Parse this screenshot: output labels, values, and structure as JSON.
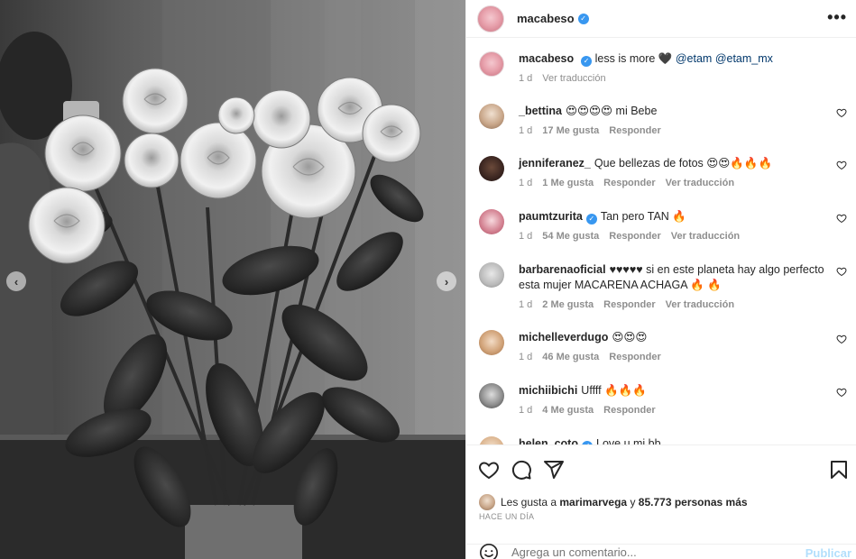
{
  "header": {
    "username": "macabeso",
    "more_label": "•••"
  },
  "caption": {
    "username": "macabeso",
    "text": "less is more 🖤",
    "mentions": [
      "@etam",
      "@etam_mx"
    ],
    "time": "1 d",
    "translate": "Ver traducción"
  },
  "comments": [
    {
      "username": "_bettina",
      "text": "😍😍😍😍 mi Bebe",
      "time": "1 d",
      "likes": "17 Me gusta",
      "reply": "Responder",
      "translate": ""
    },
    {
      "username": "jenniferanez_",
      "text": "Que bellezas de fotos 😍😍🔥🔥🔥",
      "time": "1 d",
      "likes": "1 Me gusta",
      "reply": "Responder",
      "translate": "Ver traducción"
    },
    {
      "username": "paumtzurita",
      "verified": true,
      "text": "Tan pero TAN 🔥",
      "time": "1 d",
      "likes": "54 Me gusta",
      "reply": "Responder",
      "translate": "Ver traducción"
    },
    {
      "username": "barbarenaoficial",
      "text": "♥♥♥♥♥ si en este planeta hay algo perfecto esta mujer MACARENA ACHAGA 🔥 🔥",
      "time": "1 d",
      "likes": "2 Me gusta",
      "reply": "Responder",
      "translate": "Ver traducción"
    },
    {
      "username": "michelleverdugo",
      "text": "😍😍😍",
      "time": "1 d",
      "likes": "46 Me gusta",
      "reply": "Responder",
      "translate": ""
    },
    {
      "username": "michiibichi",
      "text": "Uffff 🔥🔥🔥",
      "time": "1 d",
      "likes": "4 Me gusta",
      "reply": "Responder",
      "translate": ""
    },
    {
      "username": "helen_coto",
      "text": "Love u mi bb",
      "time": "",
      "likes": "",
      "reply": "",
      "translate": ""
    }
  ],
  "likes_bar": {
    "prefix": "Les gusta a",
    "user": "marimarvega",
    "suffix": "y",
    "count": "85.773 personas más"
  },
  "date": "HACE UN DÍA",
  "composer": {
    "placeholder": "Agrega un comentario...",
    "publish": "Publicar"
  },
  "colors": {
    "verified": "#3897f0",
    "mention": "#00376b",
    "muted": "#8e8e8e",
    "publish_disabled": "#b2dffc"
  },
  "icons": {
    "like": "heart-icon",
    "comment": "comment-icon",
    "share": "paper-plane-icon",
    "save": "bookmark-icon",
    "emoji": "smiley-icon",
    "more": "more-icon"
  }
}
